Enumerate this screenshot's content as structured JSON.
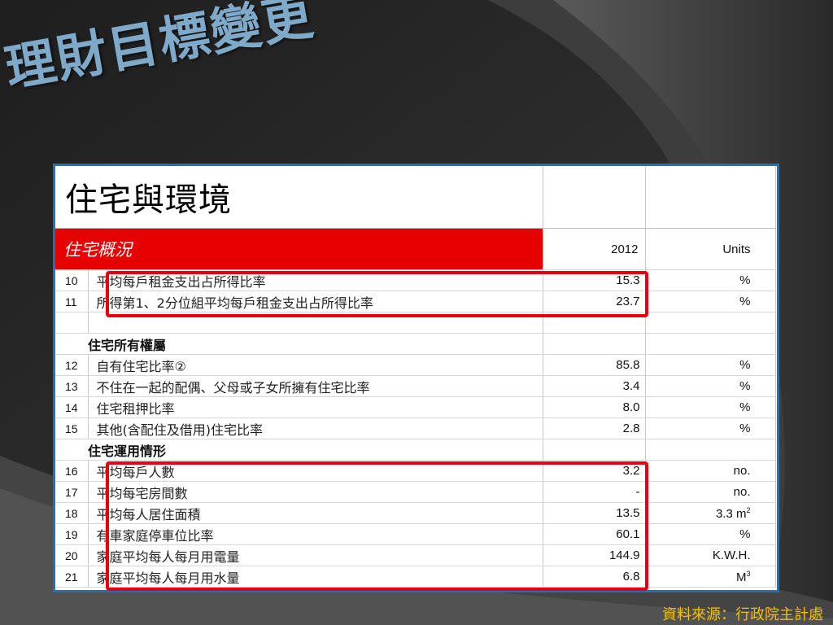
{
  "slide": {
    "title": "理財目標變更",
    "source": "資料來源：行政院主計處"
  },
  "colors": {
    "background": "#2c2c2c",
    "title": "#7ea9c9",
    "panel_border": "#1e72b8",
    "section_fill": "#e60000",
    "highlight_border": "#e8000e",
    "source_text": "#f5c100"
  },
  "table": {
    "title": "住宅與環境",
    "section": "住宅概況",
    "year_header": "2012",
    "units_header": "Units",
    "groups": {
      "ownership": "住宅所有權屬",
      "usage": "住宅運用情形"
    },
    "rows": [
      {
        "num": "10",
        "label": "平均每戶租金支出占所得比率",
        "value": "15.3",
        "unit": "%"
      },
      {
        "num": "11",
        "label": "所得第1、2分位組平均每戶租金支出占所得比率",
        "value": "23.7",
        "unit": "%"
      },
      {
        "num": "12",
        "label": "自有住宅比率②",
        "value": "85.8",
        "unit": "%"
      },
      {
        "num": "13",
        "label": "不住在一起的配偶、父母或子女所擁有住宅比率",
        "value": "3.4",
        "unit": "%"
      },
      {
        "num": "14",
        "label": "住宅租押比率",
        "value": "8.0",
        "unit": "%"
      },
      {
        "num": "15",
        "label": "其他(含配住及借用)住宅比率",
        "value": "2.8",
        "unit": "%"
      },
      {
        "num": "16",
        "label": "平均每戶人數",
        "value": "3.2",
        "unit": "no."
      },
      {
        "num": "17",
        "label": "平均每宅房間數",
        "value": "-",
        "unit": "no."
      },
      {
        "num": "18",
        "label": "平均每人居住面積",
        "value": "13.5",
        "unit": "3.3 m",
        "unit_sup": "2"
      },
      {
        "num": "19",
        "label": "有車家庭停車位比率",
        "value": "60.1",
        "unit": "%"
      },
      {
        "num": "20",
        "label": "家庭平均每人每月用電量",
        "value": "144.9",
        "unit": "K.W.H."
      },
      {
        "num": "21",
        "label": "家庭平均每人每月用水量",
        "value": "6.8",
        "unit": "M",
        "unit_sup": "3"
      }
    ]
  }
}
